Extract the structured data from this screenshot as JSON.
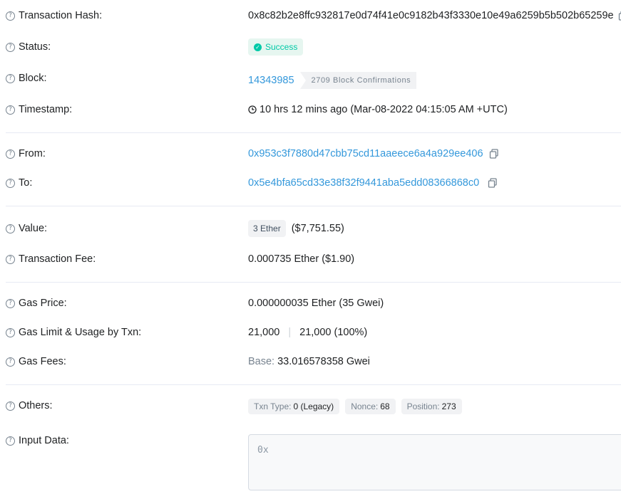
{
  "labels": {
    "tx_hash": "Transaction Hash:",
    "status": "Status:",
    "block": "Block:",
    "timestamp": "Timestamp:",
    "from": "From:",
    "to": "To:",
    "value": "Value:",
    "tx_fee": "Transaction Fee:",
    "gas_price": "Gas Price:",
    "gas_limit": "Gas Limit & Usage by Txn:",
    "gas_fees": "Gas Fees:",
    "others": "Others:",
    "input_data": "Input Data:"
  },
  "help_glyph": "?",
  "tx_hash": "0x8c82b2e8ffc932817e0d74f41e0c9182b43f3330e10e49a6259b5b502b65259e",
  "status": "Success",
  "block": {
    "number": "14343985",
    "confirmations": "2709 Block Confirmations"
  },
  "timestamp": "10 hrs 12 mins ago (Mar-08-2022 04:15:05 AM +UTC)",
  "from": "0x953c3f7880d47cbb75cd11aaeece6a4a929ee406",
  "to": "0x5e4bfa65cd33e38f32f9441aba5edd08366868c0",
  "value": {
    "ether": "3 Ether",
    "usd": "($7,751.55)"
  },
  "tx_fee": "0.000735 Ether ($1.90)",
  "gas_price": "0.000000035 Ether (35 Gwei)",
  "gas_limit": {
    "limit": "21,000",
    "separator": "|",
    "usage": "21,000 (100%)"
  },
  "gas_fees": {
    "label": "Base:",
    "value": "33.016578358 Gwei"
  },
  "others": {
    "txn_type_label": "Txn Type:",
    "txn_type_value": "0 (Legacy)",
    "nonce_label": "Nonce:",
    "nonce_value": "68",
    "position_label": "Position:",
    "position_value": "273"
  },
  "input_data": "0x",
  "colors": {
    "link": "#3498db",
    "success": "#00c9a7",
    "muted": "#77838f"
  }
}
